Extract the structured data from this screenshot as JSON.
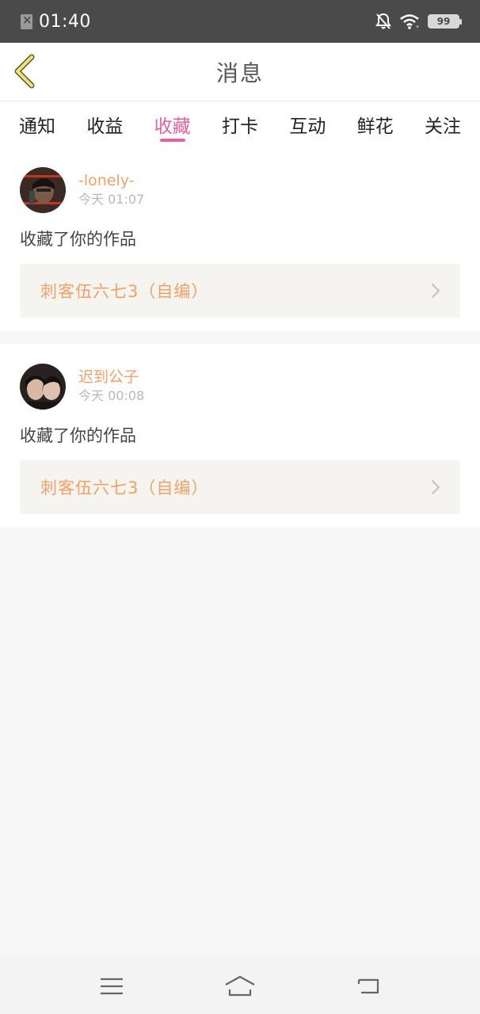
{
  "status_bar": {
    "time": "01:40",
    "battery": "99",
    "icons": [
      "sim-icon",
      "mute-icon",
      "wifi-icon",
      "battery-icon"
    ]
  },
  "header": {
    "title": "消息",
    "back_icon": "chevron-left-icon"
  },
  "tabs": [
    {
      "label": "通知",
      "active": false
    },
    {
      "label": "收益",
      "active": false
    },
    {
      "label": "收藏",
      "active": true
    },
    {
      "label": "打卡",
      "active": false
    },
    {
      "label": "互动",
      "active": false
    },
    {
      "label": "鲜花",
      "active": false
    },
    {
      "label": "关注",
      "active": false
    }
  ],
  "messages": [
    {
      "user_name": "-lonely-",
      "time": "今天 01:07",
      "action": "收藏了你的作品",
      "work_title": "刺客伍六七3（自编）"
    },
    {
      "user_name": "迟到公子",
      "time": "今天 00:08",
      "action": "收藏了你的作品",
      "work_title": "刺客伍六七3（自编）"
    }
  ],
  "nav_bar": {
    "icons": [
      "menu-icon",
      "home-icon",
      "back-icon"
    ]
  },
  "colors": {
    "accent": "#e4609f",
    "name": "#f0a06a",
    "status_bar": "#4a4a4a"
  }
}
